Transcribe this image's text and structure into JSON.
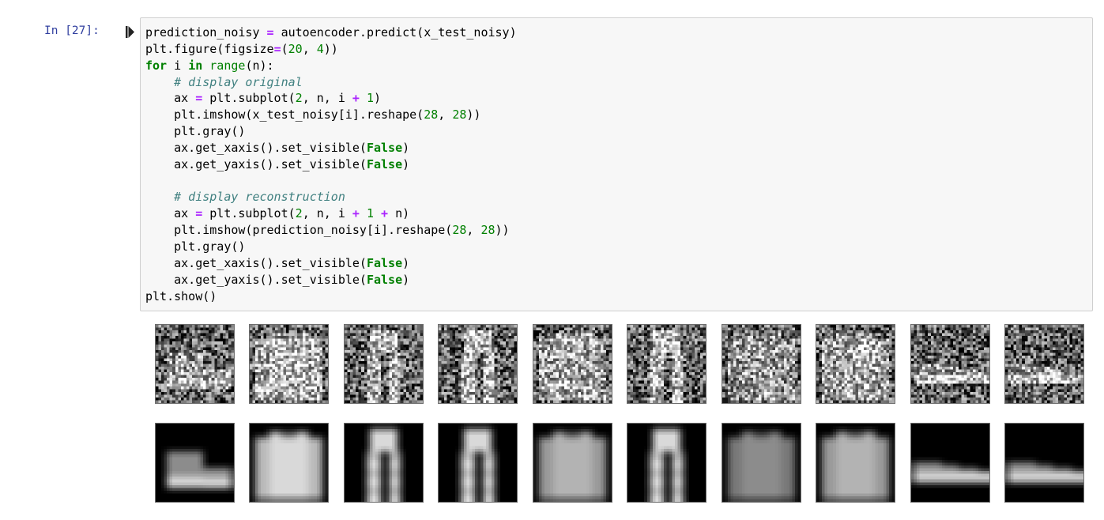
{
  "cell": {
    "prompt": "In [27]:",
    "code_lines": [
      "prediction_noisy = autoencoder.predict(x_test_noisy)",
      "plt.figure(figsize=(20, 4))",
      "for i in range(n):",
      "    # display original",
      "    ax = plt.subplot(2, n, i + 1)",
      "    plt.imshow(x_test_noisy[i].reshape(28, 28))",
      "    plt.gray()",
      "    ax.get_xaxis().set_visible(False)",
      "    ax.get_yaxis().set_visible(False)",
      "",
      "    # display reconstruction",
      "    ax = plt.subplot(2, n, i + 1 + n)",
      "    plt.imshow(prediction_noisy[i].reshape(28, 28))",
      "    plt.gray()",
      "    ax.get_xaxis().set_visible(False)",
      "    ax.get_yaxis().set_visible(False)",
      "plt.show()"
    ]
  },
  "output": {
    "noisy_images": [
      "ankle-boot",
      "pullover",
      "trouser",
      "trouser",
      "shirt",
      "trouser",
      "coat",
      "shirt",
      "sneaker",
      "sneaker"
    ],
    "reconstructed_images": [
      "ankle-boot",
      "pullover",
      "trouser",
      "trouser",
      "shirt",
      "trouser",
      "coat",
      "shirt",
      "sneaker",
      "sneaker"
    ]
  },
  "colors": {
    "prompt": "#303f9f",
    "keyword": "#008000",
    "operator": "#aa22ff",
    "comment": "#408080",
    "cell_background": "#f7f7f7",
    "cell_border": "#cfcfcf"
  }
}
